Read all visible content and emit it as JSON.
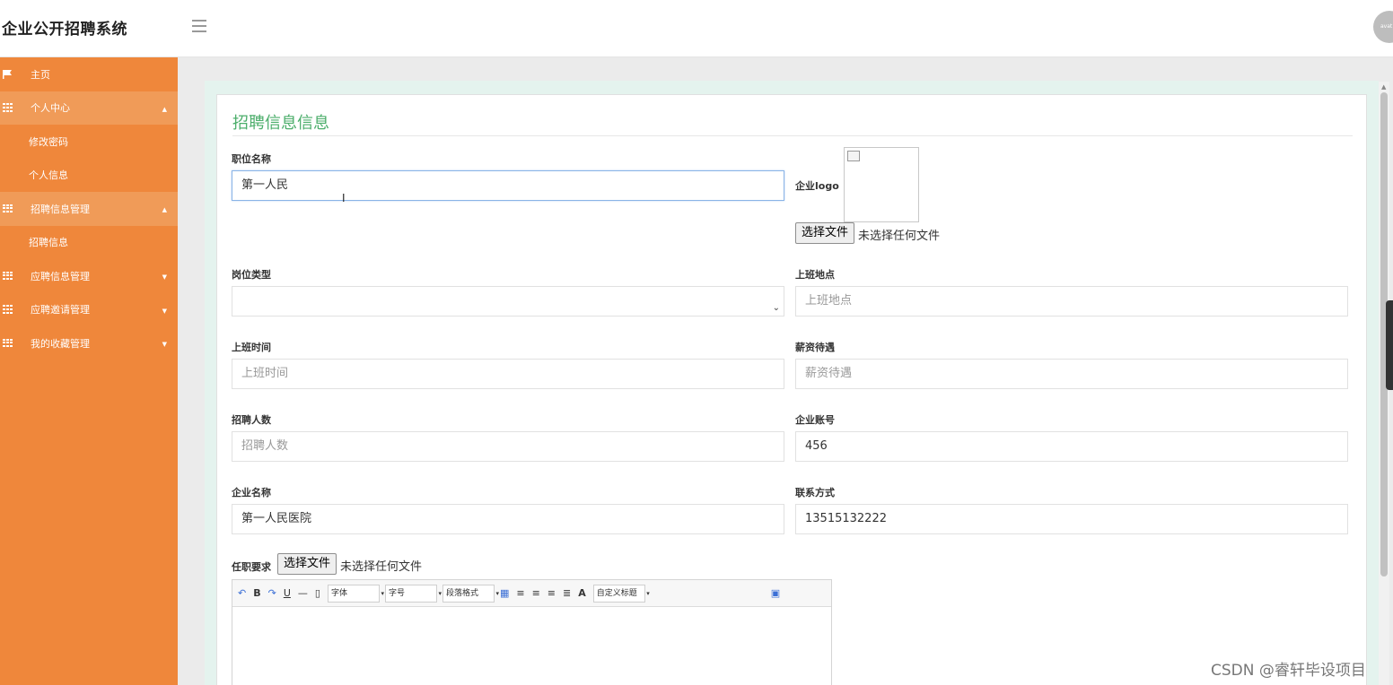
{
  "app": {
    "title": "企业公开招聘系统",
    "avatar_text": "avat"
  },
  "sidebar": {
    "home": "主页",
    "personal_center": "个人中心",
    "change_password": "修改密码",
    "personal_info": "个人信息",
    "recruit_mgmt": "招聘信息管理",
    "recruit_info": "招聘信息",
    "apply_mgmt": "应聘信息管理",
    "invite_mgmt": "应聘邀请管理",
    "favorite_mgmt": "我的收藏管理"
  },
  "form": {
    "title": "招聘信息信息",
    "position_label": "职位名称",
    "position_value": "第一人民",
    "logo_label": "企业logo",
    "file_button": "选择文件",
    "no_file": "未选择任何文件",
    "type_label": "岗位类型",
    "location_label": "上班地点",
    "location_placeholder": "上班地点",
    "time_label": "上班时间",
    "time_placeholder": "上班时间",
    "salary_label": "薪资待遇",
    "salary_placeholder": "薪资待遇",
    "count_label": "招聘人数",
    "count_placeholder": "招聘人数",
    "account_label": "企业账号",
    "account_value": "456",
    "company_label": "企业名称",
    "company_value": "第一人民医院",
    "contact_label": "联系方式",
    "contact_value": "13515132222",
    "requirement_label": "任职要求"
  },
  "editor": {
    "bold": "B",
    "underline": "U",
    "font": "字体",
    "size": "字号",
    "paragraph": "段落格式",
    "color": "A",
    "custom_title": "自定义标题"
  },
  "watermark": "CSDN @睿轩毕设项目"
}
